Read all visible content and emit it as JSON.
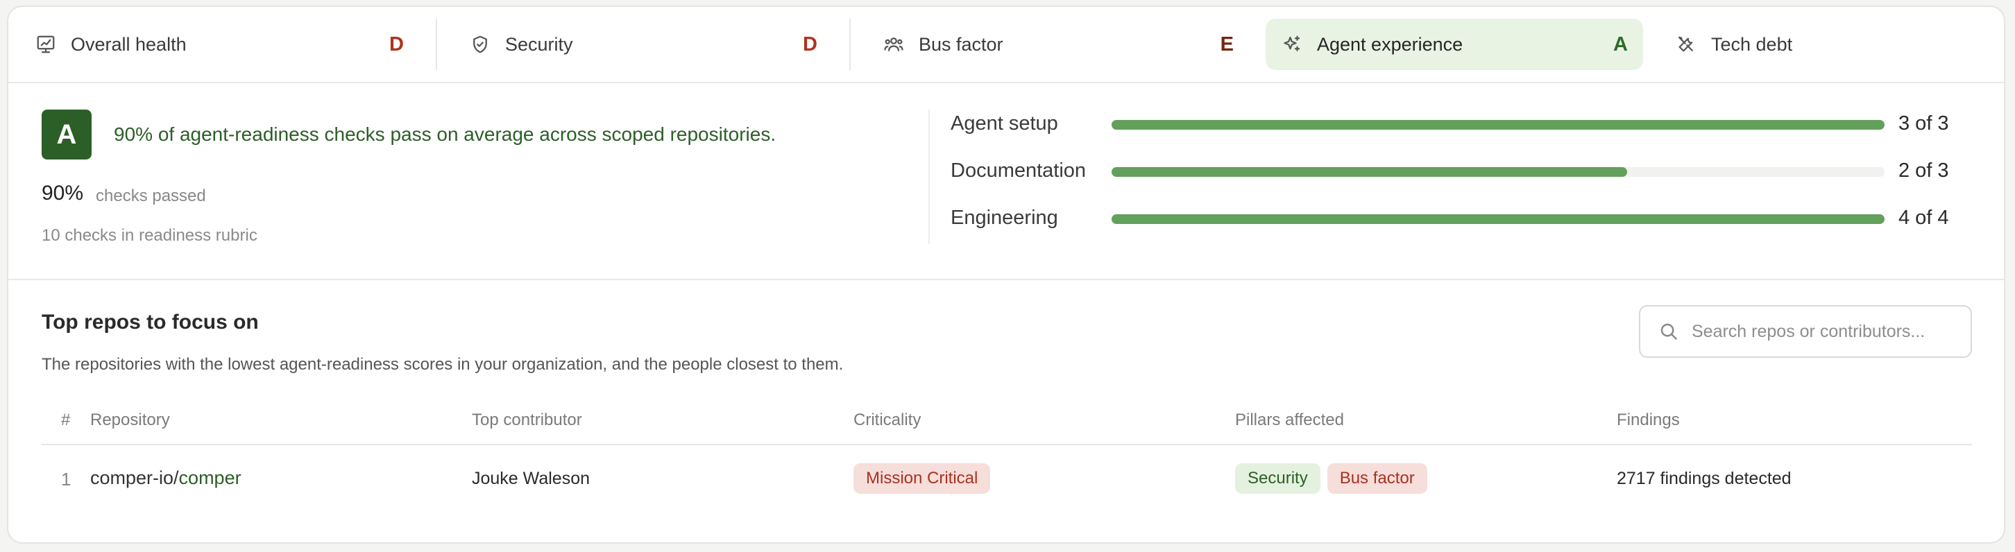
{
  "tabs": [
    {
      "label": "Overall health",
      "grade": "D",
      "icon": "chart-icon"
    },
    {
      "label": "Security",
      "grade": "D",
      "icon": "shield-icon"
    },
    {
      "label": "Bus factor",
      "grade": "E",
      "icon": "people-icon"
    },
    {
      "label": "Agent experience",
      "grade": "A",
      "icon": "sparkle-icon",
      "active": true
    },
    {
      "label": "Tech debt",
      "grade": "",
      "icon": "tools-icon"
    }
  ],
  "summary": {
    "grade": "A",
    "headline": "90% of agent-readiness checks pass on average across scoped repositories.",
    "percent": "90%",
    "percent_label": "checks passed",
    "rubric": "10 checks in readiness rubric",
    "bars": [
      {
        "name": "Agent setup",
        "value": "3 of 3",
        "fraction": 1.0
      },
      {
        "name": "Documentation",
        "value": "2 of 3",
        "fraction": 0.667
      },
      {
        "name": "Engineering",
        "value": "4 of 4",
        "fraction": 1.0
      }
    ]
  },
  "repos": {
    "title": "Top repos to focus on",
    "description": "The repositories with the lowest agent-readiness scores in your organization, and the people closest to them.",
    "search_placeholder": "Search repos or contributors...",
    "columns": [
      "#",
      "Repository",
      "Top contributor",
      "Criticality",
      "Pillars affected",
      "Findings"
    ],
    "rows": [
      {
        "index": "1",
        "repo_org": "comper-io/",
        "repo_name": "comper",
        "contributor": "Jouke Waleson",
        "criticality": "Mission Critical",
        "pillars": [
          "Security",
          "Bus factor"
        ],
        "findings": "2717 findings detected"
      }
    ]
  },
  "colors": {
    "accent_green": "#2c5e27",
    "bar_green": "#63a05b",
    "grade_red": "#b0321d",
    "active_tab_bg": "#e9f3e4"
  }
}
